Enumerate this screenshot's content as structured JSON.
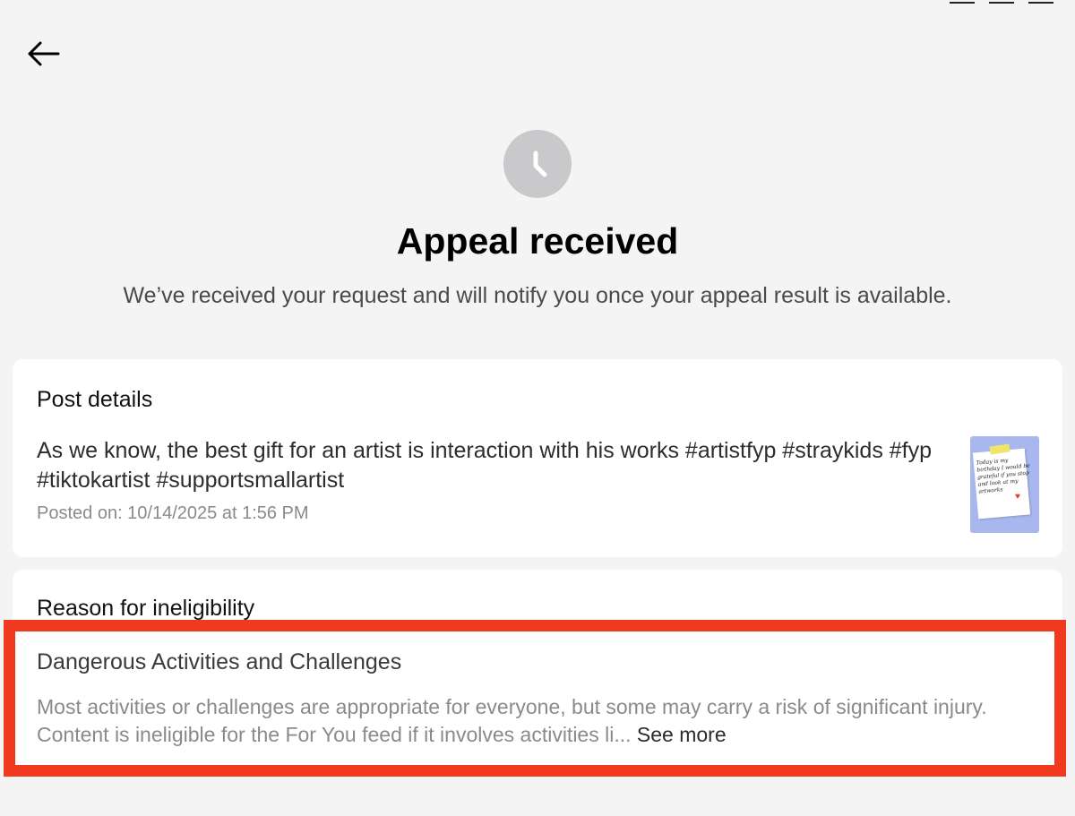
{
  "page": {
    "title": "Appeal received",
    "subtitle": "We’ve received your request and will notify you once your appeal result is available."
  },
  "post_details": {
    "heading": "Post details",
    "text": "As we know, the best gift for an artist is interaction with his works #artistfyp #straykids #fyp #tiktokartist #supportsmallartist",
    "posted_on": "Posted on: 10/14/2025 at 1:56 PM",
    "thumbnail_text": "Today is my birthday I would be grateful if you stop and look at my artworks"
  },
  "reason": {
    "heading": "Reason for ineligibility",
    "title": "Dangerous Activities and Challenges",
    "description": "Most activities or challenges are appropriate for everyone, but some may carry a risk of significant injury. Content is ineligible for the For You feed if it involves activities li...",
    "see_more": "See more"
  },
  "colors": {
    "background": "#f4f4f4",
    "card": "#ffffff",
    "highlight": "#f0391f",
    "icon_circle": "#c9c9cb"
  },
  "icons": {
    "back": "arrow-left-icon",
    "status": "clock-icon"
  }
}
